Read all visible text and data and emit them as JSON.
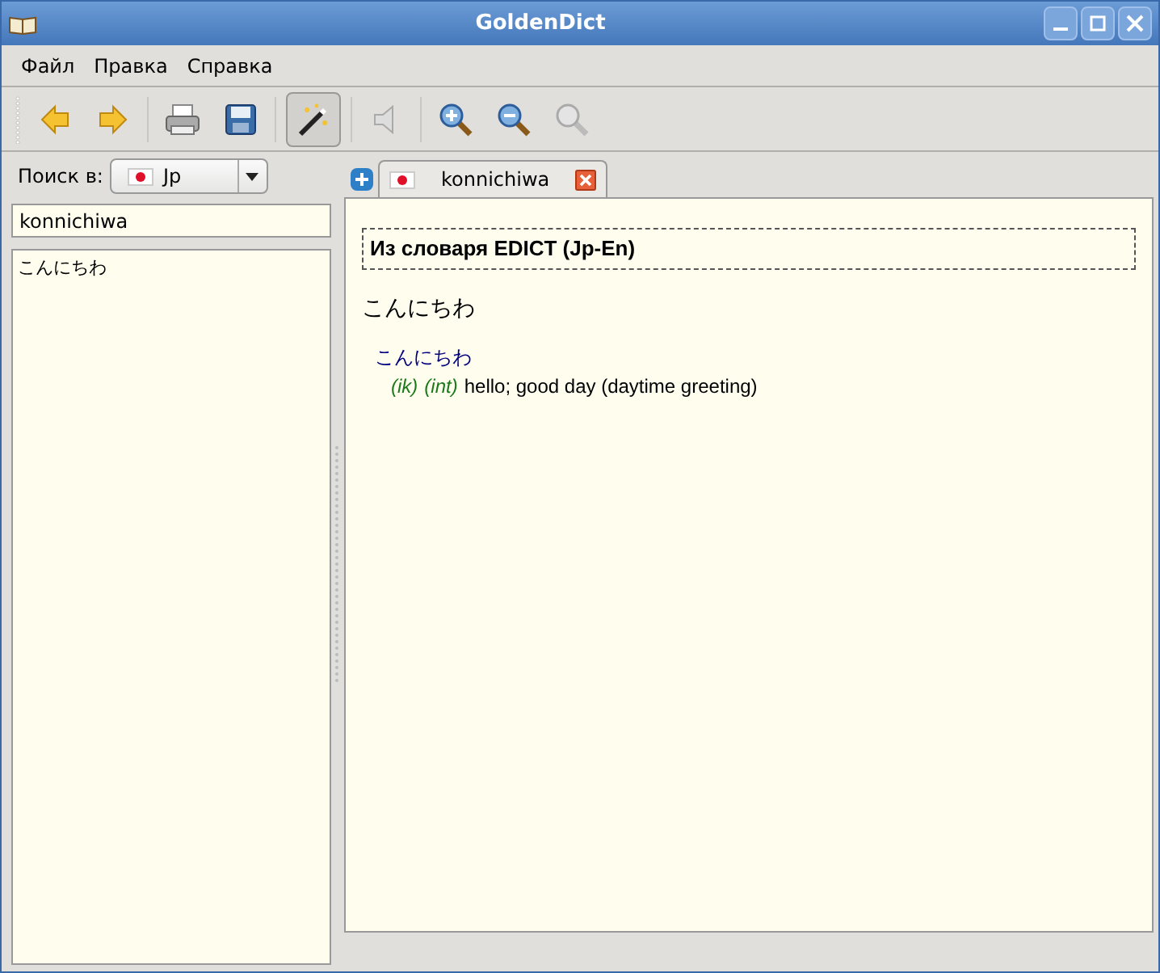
{
  "window": {
    "title": "GoldenDict"
  },
  "menu": [
    "Файл",
    "Правка",
    "Справка"
  ],
  "toolbar": [
    {
      "kind": "back",
      "disabled": false,
      "pressed": false
    },
    {
      "kind": "forward",
      "disabled": false,
      "pressed": false
    },
    {
      "kind": "print",
      "disabled": false,
      "pressed": false
    },
    {
      "kind": "save",
      "disabled": false,
      "pressed": false
    },
    {
      "kind": "wand",
      "disabled": false,
      "pressed": true
    },
    {
      "kind": "sound",
      "disabled": true,
      "pressed": false
    },
    {
      "kind": "zoomin",
      "disabled": false,
      "pressed": false
    },
    {
      "kind": "zoomout",
      "disabled": false,
      "pressed": false
    },
    {
      "kind": "zoomreset",
      "disabled": true,
      "pressed": false
    }
  ],
  "search": {
    "label": "Поиск в:",
    "group": "Jp",
    "value": "konnichiwa"
  },
  "word_list": [
    "こんにちわ"
  ],
  "tabs": [
    {
      "label": "konnichiwa",
      "selected": true
    }
  ],
  "article": {
    "dictionary": "Из словаря EDICT (Jp-En)",
    "headword": "こんにちわ",
    "reading": "こんにちわ",
    "tags": [
      "(ik)",
      "(int)"
    ],
    "definition": "hello; good day (daytime greeting)"
  }
}
